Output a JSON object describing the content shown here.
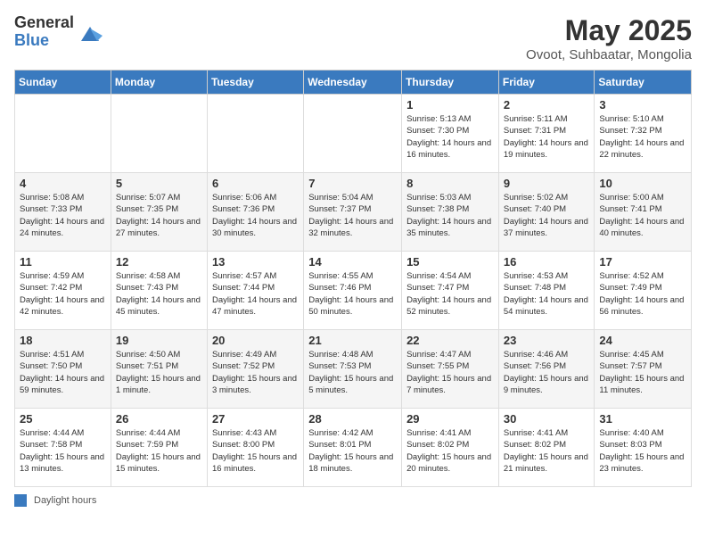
{
  "header": {
    "logo_general": "General",
    "logo_blue": "Blue",
    "month_title": "May 2025",
    "location": "Ovoot, Suhbaatar, Mongolia"
  },
  "days_of_week": [
    "Sunday",
    "Monday",
    "Tuesday",
    "Wednesday",
    "Thursday",
    "Friday",
    "Saturday"
  ],
  "weeks": [
    [
      {
        "day": "",
        "info": ""
      },
      {
        "day": "",
        "info": ""
      },
      {
        "day": "",
        "info": ""
      },
      {
        "day": "",
        "info": ""
      },
      {
        "day": "1",
        "info": "Sunrise: 5:13 AM\nSunset: 7:30 PM\nDaylight: 14 hours and 16 minutes."
      },
      {
        "day": "2",
        "info": "Sunrise: 5:11 AM\nSunset: 7:31 PM\nDaylight: 14 hours and 19 minutes."
      },
      {
        "day": "3",
        "info": "Sunrise: 5:10 AM\nSunset: 7:32 PM\nDaylight: 14 hours and 22 minutes."
      }
    ],
    [
      {
        "day": "4",
        "info": "Sunrise: 5:08 AM\nSunset: 7:33 PM\nDaylight: 14 hours and 24 minutes."
      },
      {
        "day": "5",
        "info": "Sunrise: 5:07 AM\nSunset: 7:35 PM\nDaylight: 14 hours and 27 minutes."
      },
      {
        "day": "6",
        "info": "Sunrise: 5:06 AM\nSunset: 7:36 PM\nDaylight: 14 hours and 30 minutes."
      },
      {
        "day": "7",
        "info": "Sunrise: 5:04 AM\nSunset: 7:37 PM\nDaylight: 14 hours and 32 minutes."
      },
      {
        "day": "8",
        "info": "Sunrise: 5:03 AM\nSunset: 7:38 PM\nDaylight: 14 hours and 35 minutes."
      },
      {
        "day": "9",
        "info": "Sunrise: 5:02 AM\nSunset: 7:40 PM\nDaylight: 14 hours and 37 minutes."
      },
      {
        "day": "10",
        "info": "Sunrise: 5:00 AM\nSunset: 7:41 PM\nDaylight: 14 hours and 40 minutes."
      }
    ],
    [
      {
        "day": "11",
        "info": "Sunrise: 4:59 AM\nSunset: 7:42 PM\nDaylight: 14 hours and 42 minutes."
      },
      {
        "day": "12",
        "info": "Sunrise: 4:58 AM\nSunset: 7:43 PM\nDaylight: 14 hours and 45 minutes."
      },
      {
        "day": "13",
        "info": "Sunrise: 4:57 AM\nSunset: 7:44 PM\nDaylight: 14 hours and 47 minutes."
      },
      {
        "day": "14",
        "info": "Sunrise: 4:55 AM\nSunset: 7:46 PM\nDaylight: 14 hours and 50 minutes."
      },
      {
        "day": "15",
        "info": "Sunrise: 4:54 AM\nSunset: 7:47 PM\nDaylight: 14 hours and 52 minutes."
      },
      {
        "day": "16",
        "info": "Sunrise: 4:53 AM\nSunset: 7:48 PM\nDaylight: 14 hours and 54 minutes."
      },
      {
        "day": "17",
        "info": "Sunrise: 4:52 AM\nSunset: 7:49 PM\nDaylight: 14 hours and 56 minutes."
      }
    ],
    [
      {
        "day": "18",
        "info": "Sunrise: 4:51 AM\nSunset: 7:50 PM\nDaylight: 14 hours and 59 minutes."
      },
      {
        "day": "19",
        "info": "Sunrise: 4:50 AM\nSunset: 7:51 PM\nDaylight: 15 hours and 1 minute."
      },
      {
        "day": "20",
        "info": "Sunrise: 4:49 AM\nSunset: 7:52 PM\nDaylight: 15 hours and 3 minutes."
      },
      {
        "day": "21",
        "info": "Sunrise: 4:48 AM\nSunset: 7:53 PM\nDaylight: 15 hours and 5 minutes."
      },
      {
        "day": "22",
        "info": "Sunrise: 4:47 AM\nSunset: 7:55 PM\nDaylight: 15 hours and 7 minutes."
      },
      {
        "day": "23",
        "info": "Sunrise: 4:46 AM\nSunset: 7:56 PM\nDaylight: 15 hours and 9 minutes."
      },
      {
        "day": "24",
        "info": "Sunrise: 4:45 AM\nSunset: 7:57 PM\nDaylight: 15 hours and 11 minutes."
      }
    ],
    [
      {
        "day": "25",
        "info": "Sunrise: 4:44 AM\nSunset: 7:58 PM\nDaylight: 15 hours and 13 minutes."
      },
      {
        "day": "26",
        "info": "Sunrise: 4:44 AM\nSunset: 7:59 PM\nDaylight: 15 hours and 15 minutes."
      },
      {
        "day": "27",
        "info": "Sunrise: 4:43 AM\nSunset: 8:00 PM\nDaylight: 15 hours and 16 minutes."
      },
      {
        "day": "28",
        "info": "Sunrise: 4:42 AM\nSunset: 8:01 PM\nDaylight: 15 hours and 18 minutes."
      },
      {
        "day": "29",
        "info": "Sunrise: 4:41 AM\nSunset: 8:02 PM\nDaylight: 15 hours and 20 minutes."
      },
      {
        "day": "30",
        "info": "Sunrise: 4:41 AM\nSunset: 8:02 PM\nDaylight: 15 hours and 21 minutes."
      },
      {
        "day": "31",
        "info": "Sunrise: 4:40 AM\nSunset: 8:03 PM\nDaylight: 15 hours and 23 minutes."
      }
    ]
  ],
  "footer": {
    "label": "Daylight hours"
  }
}
